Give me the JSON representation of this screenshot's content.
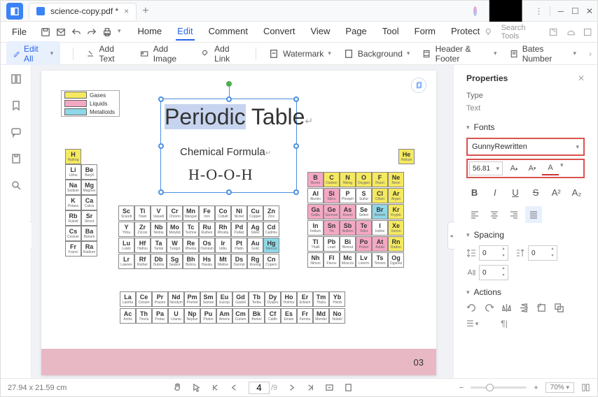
{
  "tab": {
    "title": "science-copy.pdf *"
  },
  "file_menu": "File",
  "menu": [
    "Home",
    "Edit",
    "Comment",
    "Convert",
    "View",
    "Page",
    "Tool",
    "Form",
    "Protect"
  ],
  "active_menu": 1,
  "search_placeholder": "Search Tools",
  "toolbar": {
    "edit_all": "Edit All",
    "items": [
      "Add Text",
      "Add Image",
      "Add Link",
      "Watermark",
      "Background",
      "Header & Footer",
      "Bates Number"
    ]
  },
  "legend": [
    {
      "label": "Gases",
      "color": "#f5e960"
    },
    {
      "label": "Liquids",
      "color": "#f4a8c4"
    },
    {
      "label": "Metalloids",
      "color": "#8fd8e8"
    }
  ],
  "doc": {
    "title_word1": "Periodic",
    "title_word2": " Table",
    "subtitle": "Chemical Formula",
    "formula": "H-O-O-H",
    "page_num": "03"
  },
  "elements": {
    "row1": [
      {
        "s": "H",
        "sub": "Hydrogen",
        "c": "yellow"
      }
    ],
    "row1r": [
      {
        "s": "He",
        "sub": "Helium",
        "c": "yellow"
      }
    ],
    "row2l": [
      {
        "s": "Li",
        "sub": "Lithium"
      },
      {
        "s": "Be",
        "sub": "Beryllium"
      }
    ],
    "row2r": [
      {
        "s": "B",
        "sub": "Boron",
        "c": "pink"
      },
      {
        "s": "C",
        "sub": "Carbon",
        "c": "yellow"
      },
      {
        "s": "N",
        "sub": "Nitrogen",
        "c": "yellow"
      },
      {
        "s": "O",
        "sub": "Oxygen",
        "c": "yellow"
      },
      {
        "s": "F",
        "sub": "Fluorine",
        "c": "yellow"
      },
      {
        "s": "Ne",
        "sub": "Neon",
        "c": "yellow"
      }
    ],
    "row3l": [
      {
        "s": "Na",
        "sub": "Sodium"
      },
      {
        "s": "Mg",
        "sub": "Magnesium"
      }
    ],
    "row3r": [
      {
        "s": "Al",
        "sub": "Aluminum"
      },
      {
        "s": "Si",
        "sub": "Silicon",
        "c": "pink"
      },
      {
        "s": "P",
        "sub": "Phosphorus"
      },
      {
        "s": "S",
        "sub": "Sulfur"
      },
      {
        "s": "Cl",
        "sub": "Chlorine",
        "c": "yellow"
      },
      {
        "s": "Ar",
        "sub": "Argon",
        "c": "yellow"
      }
    ],
    "row4l": [
      {
        "s": "K",
        "sub": "Potassium"
      },
      {
        "s": "Ca",
        "sub": "Calcium"
      }
    ],
    "row4m": [
      {
        "s": "Sc",
        "sub": "Scandium"
      },
      {
        "s": "Ti",
        "sub": "Titanium"
      },
      {
        "s": "V",
        "sub": "Vanadium"
      },
      {
        "s": "Cr",
        "sub": "Chromium"
      },
      {
        "s": "Mn",
        "sub": "Manganese"
      },
      {
        "s": "Fe",
        "sub": "Iron"
      },
      {
        "s": "Co",
        "sub": "Cobalt"
      },
      {
        "s": "Ni",
        "sub": "Nickel"
      },
      {
        "s": "Cu",
        "sub": "Copper"
      },
      {
        "s": "Zn",
        "sub": "Zinc"
      }
    ],
    "row4r": [
      {
        "s": "Ga",
        "sub": "Gallium",
        "c": "pink"
      },
      {
        "s": "Ge",
        "sub": "Germanium",
        "c": "pink"
      },
      {
        "s": "As",
        "sub": "Arsenic",
        "c": "pink"
      },
      {
        "s": "Se",
        "sub": "Selenium"
      },
      {
        "s": "Br",
        "sub": "Bromine",
        "c": "cyan"
      },
      {
        "s": "Kr",
        "sub": "Krypton",
        "c": "yellow"
      }
    ],
    "row5l": [
      {
        "s": "Rb",
        "sub": "Rubidium"
      },
      {
        "s": "Sr",
        "sub": "Strontium"
      }
    ],
    "row5m": [
      {
        "s": "Y",
        "sub": "Yttrium"
      },
      {
        "s": "Zr",
        "sub": "Zirconium"
      },
      {
        "s": "Nb",
        "sub": "Niobium"
      },
      {
        "s": "Mo",
        "sub": "Molybdenum"
      },
      {
        "s": "Tc",
        "sub": "Technetium"
      },
      {
        "s": "Ru",
        "sub": "Ruthenium"
      },
      {
        "s": "Rh",
        "sub": "Rhodium"
      },
      {
        "s": "Pd",
        "sub": "Palladium"
      },
      {
        "s": "Ag",
        "sub": "Silver"
      },
      {
        "s": "Cd",
        "sub": "Cadmium"
      }
    ],
    "row5r": [
      {
        "s": "In",
        "sub": "Indium"
      },
      {
        "s": "Sn",
        "sub": "Tin",
        "c": "pink"
      },
      {
        "s": "Sb",
        "sub": "Antimony",
        "c": "pink"
      },
      {
        "s": "Te",
        "sub": "Tellurium",
        "c": "pink"
      },
      {
        "s": "I",
        "sub": "Iodine"
      },
      {
        "s": "Xe",
        "sub": "Xenon",
        "c": "yellow"
      }
    ],
    "row6l": [
      {
        "s": "Cs",
        "sub": "Cesium"
      },
      {
        "s": "Ba",
        "sub": "Barium"
      }
    ],
    "row6m": [
      {
        "s": "Lu",
        "sub": "Lutetium"
      },
      {
        "s": "Hf",
        "sub": "Hafnium"
      },
      {
        "s": "Ta",
        "sub": "Tantalum"
      },
      {
        "s": "W",
        "sub": "Tungsten"
      },
      {
        "s": "Re",
        "sub": "Rhenium"
      },
      {
        "s": "Os",
        "sub": "Osmium"
      },
      {
        "s": "Ir",
        "sub": "Iridium"
      },
      {
        "s": "Pt",
        "sub": "Platinum"
      },
      {
        "s": "Au",
        "sub": "Gold"
      },
      {
        "s": "Hg",
        "sub": "Mercury",
        "c": "cyan"
      }
    ],
    "row6r": [
      {
        "s": "Tl",
        "sub": "Thallium"
      },
      {
        "s": "Pb",
        "sub": "Lead"
      },
      {
        "s": "Bi",
        "sub": "Bismuth"
      },
      {
        "s": "Po",
        "sub": "Polonium",
        "c": "pink"
      },
      {
        "s": "At",
        "sub": "Astatine",
        "c": "pink"
      },
      {
        "s": "Rn",
        "sub": "Radon",
        "c": "yellow"
      }
    ],
    "row7l": [
      {
        "s": "Fr",
        "sub": "Francium"
      },
      {
        "s": "Ra",
        "sub": "Radium"
      }
    ],
    "row7m": [
      {
        "s": "Lr",
        "sub": "Lawrencium"
      },
      {
        "s": "Rf",
        "sub": "Rutherfordium"
      },
      {
        "s": "Db",
        "sub": "Dubnium"
      },
      {
        "s": "Sg",
        "sub": "Seaborgium"
      },
      {
        "s": "Bh",
        "sub": "Bohrium"
      },
      {
        "s": "Hs",
        "sub": "Hassium"
      },
      {
        "s": "Mt",
        "sub": "Meitnerium"
      },
      {
        "s": "Ds",
        "sub": "Darmstadtium"
      },
      {
        "s": "Rg",
        "sub": "Roentgenium"
      },
      {
        "s": "Cn",
        "sub": "Copernicium"
      }
    ],
    "row7r": [
      {
        "s": "Nh",
        "sub": "Nihonium"
      },
      {
        "s": "Fl",
        "sub": "Flerovium"
      },
      {
        "s": "Mc",
        "sub": "Moscovium"
      },
      {
        "s": "Lv",
        "sub": "Livermorium"
      },
      {
        "s": "Ts",
        "sub": "Tennessine"
      },
      {
        "s": "Og",
        "sub": "Oganesson"
      }
    ],
    "lan": [
      {
        "s": "La",
        "sub": "Lanthanum"
      },
      {
        "s": "Ce",
        "sub": "Cerium"
      },
      {
        "s": "Pr",
        "sub": "Praseodymium"
      },
      {
        "s": "Nd",
        "sub": "Neodymium"
      },
      {
        "s": "Pm",
        "sub": "Promethium"
      },
      {
        "s": "Sm",
        "sub": "Samarium"
      },
      {
        "s": "Eu",
        "sub": "Europium"
      },
      {
        "s": "Gd",
        "sub": "Gadolinium"
      },
      {
        "s": "Tb",
        "sub": "Terbium"
      },
      {
        "s": "Dy",
        "sub": "Dysprosium"
      },
      {
        "s": "Ho",
        "sub": "Holmium"
      },
      {
        "s": "Er",
        "sub": "Erbium"
      },
      {
        "s": "Tm",
        "sub": "Thulium"
      },
      {
        "s": "Yb",
        "sub": "Ytterbium"
      }
    ],
    "act": [
      {
        "s": "Ac",
        "sub": "Actinium"
      },
      {
        "s": "Th",
        "sub": "Thorium"
      },
      {
        "s": "Pa",
        "sub": "Protactinium"
      },
      {
        "s": "U",
        "sub": "Uranium"
      },
      {
        "s": "Np",
        "sub": "Neptunium"
      },
      {
        "s": "Pu",
        "sub": "Plutonium"
      },
      {
        "s": "Am",
        "sub": "Americium"
      },
      {
        "s": "Cm",
        "sub": "Curium"
      },
      {
        "s": "Bk",
        "sub": "Berkelium"
      },
      {
        "s": "Cf",
        "sub": "Californium"
      },
      {
        "s": "Es",
        "sub": "Einsteinium"
      },
      {
        "s": "Fr",
        "sub": "Fermium"
      },
      {
        "s": "Md",
        "sub": "Mendelevium"
      },
      {
        "s": "No",
        "sub": "Nobelium"
      }
    ]
  },
  "props": {
    "title": "Properties",
    "type_label": "Type",
    "type_value": "Text",
    "fonts_label": "Fonts",
    "font_name": "GunnyRewritten",
    "font_size": "56.81",
    "spacing_label": "Spacing",
    "spacing_vals": [
      "0",
      "0",
      "0"
    ],
    "actions_label": "Actions"
  },
  "status": {
    "dims": "27.94 x 21.59 cm",
    "page": "4",
    "total": "/9",
    "zoom": "70%"
  }
}
